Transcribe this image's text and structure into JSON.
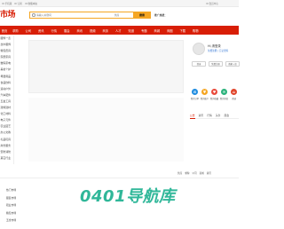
{
  "topbar": {
    "items": [
      "手机版",
      "订阅",
      "收藏本站"
    ],
    "right": "会员中心"
  },
  "logo": {
    "text": "市场"
  },
  "search": {
    "placeholder": "请输入关键词",
    "category": "供应",
    "button": "搜索",
    "hint": "推广热搜："
  },
  "nav": {
    "items": [
      "首页",
      "求购",
      "公司",
      "资讯",
      "行情",
      "展会",
      "商讯",
      "视频",
      "商务",
      "人才",
      "知道",
      "专题",
      "商城",
      "商圈",
      "下载",
      "购物"
    ]
  },
  "sidebar": {
    "items": [
      "服饰一览",
      "丝巾服饰",
      "箱包皮具",
      "家居家具",
      "数码家电",
      "美妆个护",
      "母婴用品",
      "食品饮料",
      "运动户外",
      "汽车配件",
      "五金工具",
      "建筑建材",
      "化工材料",
      "电子元件",
      "农业园艺",
      "办公文教",
      "礼品玩具",
      "商务服务",
      "安防消防",
      "其它行业"
    ]
  },
  "user": {
    "greeting": "Hi,请登录",
    "login_line": "免费注册 | 忘记密码",
    "buttons": [
      "登录",
      "免费注册",
      "商家入驻"
    ],
    "shortcuts": [
      {
        "icon": "cart-icon",
        "label": "我的订单",
        "color": "#1e8ce0"
      },
      {
        "icon": "currency-icon",
        "label": "我的账户",
        "color": "#f5a623"
      },
      {
        "icon": "heart-icon",
        "label": "我的收藏",
        "color": "#e94b3c"
      },
      {
        "icon": "message-icon",
        "label": "我的消息",
        "color": "#2ab27b"
      },
      {
        "icon": "home-icon",
        "label": "商铺",
        "color": "#e0452b"
      }
    ],
    "tabs": [
      "公告",
      "资讯",
      "行情",
      "头条",
      "展会"
    ]
  },
  "section2": {
    "links": [
      "供应",
      "求购",
      "公司",
      "商城",
      "资讯"
    ],
    "sidebar": [
      "热门市场",
      "服装市场",
      "鞋业市场",
      "箱包市场",
      "五金市场"
    ]
  },
  "watermark": {
    "text": "0401导航库"
  }
}
